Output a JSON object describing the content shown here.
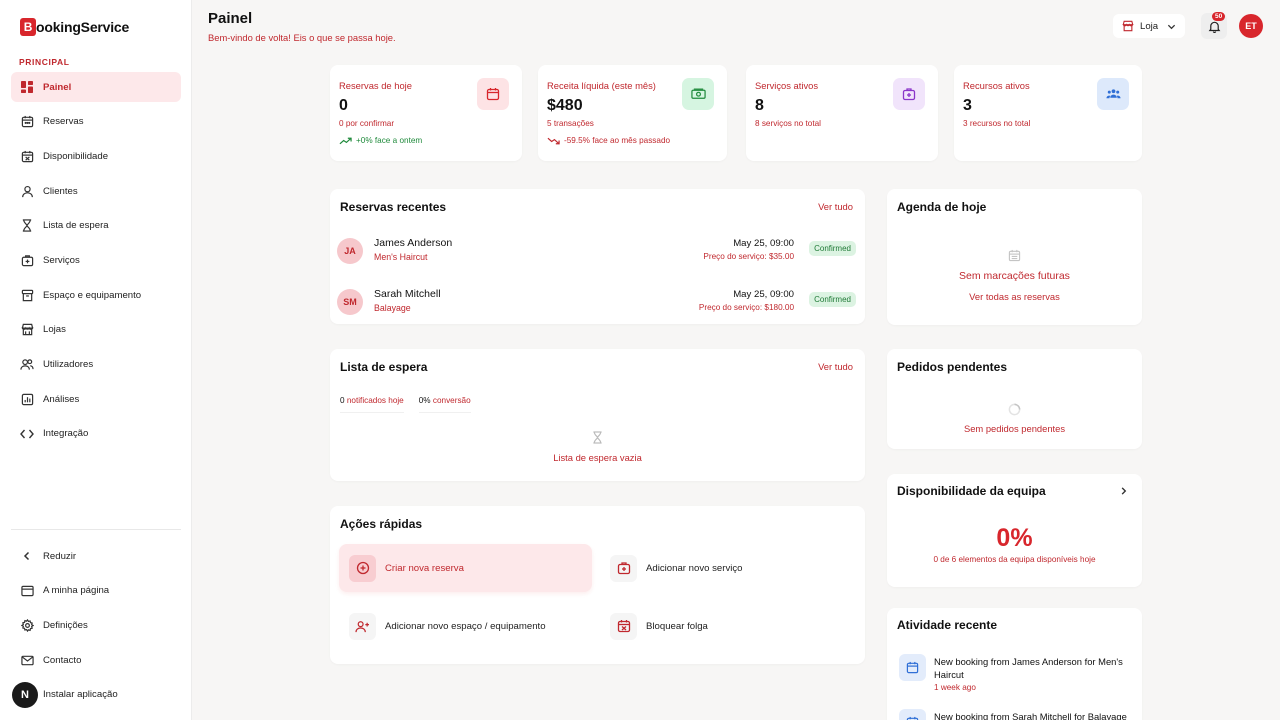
{
  "brand": {
    "mark": "B",
    "name": "ookingService",
    "color": "#d8262c"
  },
  "sidebar": {
    "section_label": "PRINCIPAL",
    "items": [
      {
        "label": "Painel",
        "icon": "grid-icon",
        "active": true
      },
      {
        "label": "Reservas",
        "icon": "calendar-icon"
      },
      {
        "label": "Disponibilidade",
        "icon": "calendar-x-icon"
      },
      {
        "label": "Clientes",
        "icon": "user-icon"
      },
      {
        "label": "Lista de espera",
        "icon": "hourglass-icon"
      },
      {
        "label": "Serviços",
        "icon": "briefcase-plus-icon"
      },
      {
        "label": "Espaço e equipamento",
        "icon": "archive-icon"
      },
      {
        "label": "Lojas",
        "icon": "store-icon"
      },
      {
        "label": "Utilizadores",
        "icon": "users-icon"
      },
      {
        "label": "Análises",
        "icon": "chart-icon"
      },
      {
        "label": "Integração",
        "icon": "code-icon"
      }
    ],
    "bottom": [
      {
        "label": "Reduzir",
        "icon": "chevron-left-icon"
      },
      {
        "label": "A minha página",
        "icon": "window-icon"
      },
      {
        "label": "Definições",
        "icon": "gear-icon"
      },
      {
        "label": "Contacto",
        "icon": "mail-icon"
      },
      {
        "label": "Instalar aplicação",
        "icon": "install-icon",
        "avatar": "N"
      }
    ]
  },
  "header": {
    "title": "Painel",
    "subtitle": "Bem-vindo de volta! Eis o que se passa hoje.",
    "store": "Loja",
    "notifications": "50",
    "user_initials": "ET"
  },
  "stats": [
    {
      "label": "Reservas de hoje",
      "value": "0",
      "sub": "0 por confirmar",
      "trend": "+0% face a ontem",
      "trend_dir": "up",
      "icon": "calendar-icon",
      "tile_bg": "#fde3e5",
      "tile_fg": "#d8262c"
    },
    {
      "label": "Receita líquida (este mês)",
      "value": "$480",
      "sub": "5 transações",
      "trend": "-59.5% face ao mês passado",
      "trend_dir": "down",
      "icon": "money-icon",
      "tile_bg": "#d6f5e1",
      "tile_fg": "#1f8a3b"
    },
    {
      "label": "Serviços ativos",
      "value": "8",
      "sub": "8 serviços no total",
      "trend": "",
      "icon": "briefcase-plus-icon",
      "tile_bg": "#f1e4fb",
      "tile_fg": "#8b35c9"
    },
    {
      "label": "Recursos ativos",
      "value": "3",
      "sub": "3 recursos no total",
      "trend": "",
      "icon": "users-icon",
      "tile_bg": "#dde9fb",
      "tile_fg": "#2f6fd6"
    }
  ],
  "recent_bookings": {
    "title": "Reservas recentes",
    "link": "Ver tudo",
    "rows": [
      {
        "initials": "JA",
        "name": "James Anderson",
        "service": "Men's Haircut",
        "date": "May 25, 09:00",
        "price": "Preço do serviço: $35.00",
        "status": "Confirmed"
      },
      {
        "initials": "SM",
        "name": "Sarah Mitchell",
        "service": "Balayage",
        "date": "May 25, 09:00",
        "price": "Preço do serviço: $180.00",
        "status": "Confirmed"
      }
    ]
  },
  "waitlist": {
    "title": "Lista de espera",
    "link": "Ver tudo",
    "notified_num": "0",
    "notified_txt": "notificados hoje",
    "conv_num": "0%",
    "conv_txt": "conversão",
    "empty": "Lista de espera vazia"
  },
  "quick_actions": {
    "title": "Ações rápidas",
    "items": [
      {
        "label": "Criar nova reserva",
        "icon": "plus-circle-icon"
      },
      {
        "label": "Adicionar novo serviço",
        "icon": "briefcase-plus-icon"
      },
      {
        "label": "Adicionar novo espaço / equipamento",
        "icon": "user-plus-icon"
      },
      {
        "label": "Bloquear folga",
        "icon": "calendar-x-icon"
      }
    ]
  },
  "agenda": {
    "title": "Agenda de hoje",
    "empty": "Sem marcações futuras",
    "link": "Ver todas as reservas"
  },
  "pending": {
    "title": "Pedidos pendentes",
    "empty": "Sem pedidos pendentes"
  },
  "team": {
    "title": "Disponibilidade da equipa",
    "percent": "0%",
    "sub": "0 de 6 elementos da equipa disponíveis hoje"
  },
  "activity": {
    "title": "Atividade recente",
    "items": [
      {
        "text": "New booking from James Anderson for Men's Haircut",
        "time": "1 week ago"
      },
      {
        "text": "New booking from Sarah Mitchell for Balayage",
        "time": ""
      }
    ]
  }
}
